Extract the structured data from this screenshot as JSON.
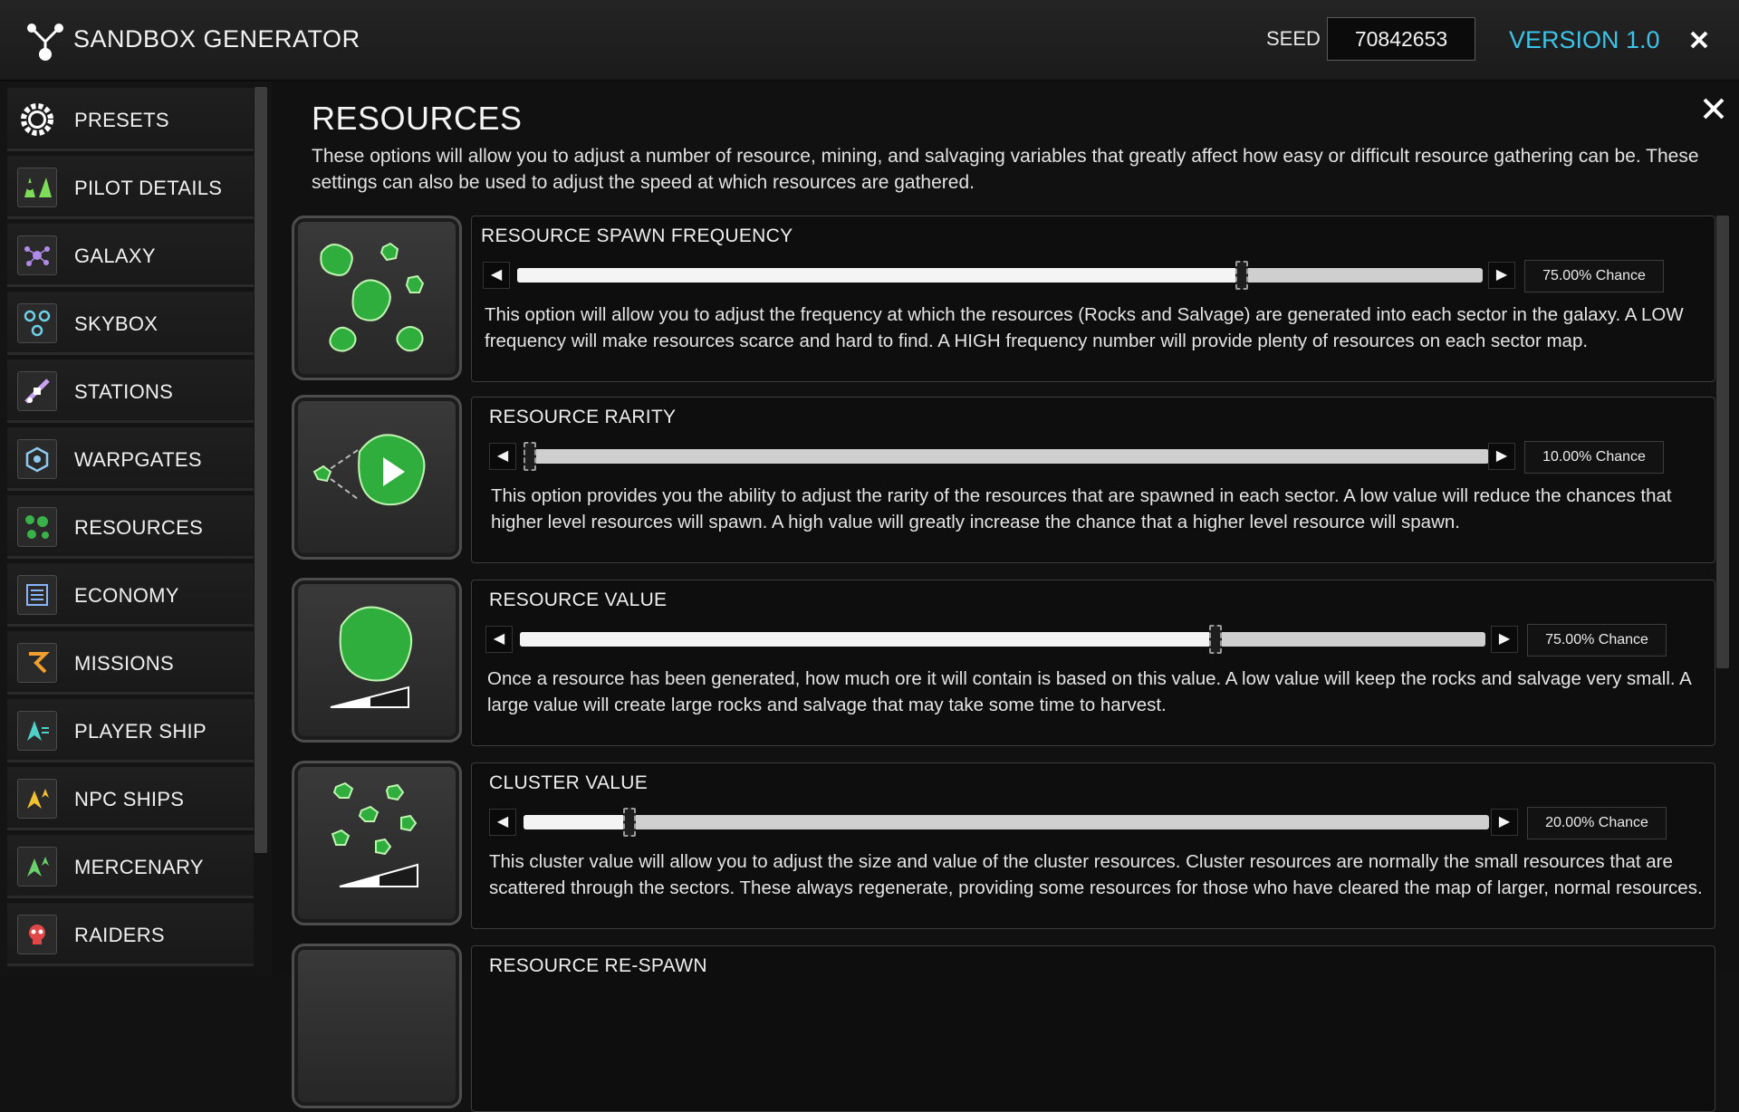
{
  "app": {
    "title": "SANDBOX GENERATOR",
    "seed_label": "SEED",
    "seed_value": "70842653",
    "version": "VERSION 1.0",
    "accent_color": "#3ec2e6"
  },
  "sidebar": {
    "items": [
      {
        "label": "PRESETS",
        "icon": "gear-icon"
      },
      {
        "label": "PILOT DETAILS",
        "icon": "pilot-icon"
      },
      {
        "label": "GALAXY",
        "icon": "galaxy-icon"
      },
      {
        "label": "SKYBOX",
        "icon": "skybox-icon"
      },
      {
        "label": "STATIONS",
        "icon": "station-icon"
      },
      {
        "label": "WARPGATES",
        "icon": "warpgate-icon"
      },
      {
        "label": "RESOURCES",
        "icon": "resources-icon"
      },
      {
        "label": "ECONOMY",
        "icon": "economy-icon"
      },
      {
        "label": "MISSIONS",
        "icon": "missions-icon"
      },
      {
        "label": "PLAYER SHIP",
        "icon": "player-ship-icon"
      },
      {
        "label": "NPC SHIPS",
        "icon": "npc-ships-icon"
      },
      {
        "label": "MERCENARY",
        "icon": "mercenary-icon"
      },
      {
        "label": "RAIDERS",
        "icon": "raiders-icon"
      }
    ]
  },
  "main": {
    "title": "RESOURCES",
    "description": "These options will allow you to adjust a number of resource, mining, and salvaging variables that greatly affect how easy or difficult resource gathering can be. These settings can also be used to adjust the speed at which resources are gathered.",
    "settings": [
      {
        "title": "RESOURCE SPAWN FREQUENCY",
        "value_text": "75.00% Chance",
        "value": 0.75,
        "icon": "resource-cluster-icon",
        "description": "This option will allow you to adjust the frequency at which the resources (Rocks and Salvage) are generated into each sector in the galaxy. A LOW frequency will make resources scarce and hard to find. A HIGH frequency number will provide plenty of resources on each sector map."
      },
      {
        "title": "RESOURCE RARITY",
        "value_text": "10.00% Chance",
        "value": 0.0,
        "icon": "resource-rarity-icon",
        "description": "This option provides you the ability to adjust the rarity of the resources that are spawned in each sector. A low value will reduce the chances that higher level resources will spawn. A high value will greatly increase the chance that a higher level resource will spawn."
      },
      {
        "title": "RESOURCE VALUE",
        "value_text": "75.00% Chance",
        "value": 0.72,
        "icon": "resource-value-icon",
        "description": "Once a resource has been generated, how much ore it will contain is based on this value. A low value will keep the rocks and salvage very small. A large value will create large rocks and salvage that may take some time to harvest."
      },
      {
        "title": "CLUSTER VALUE",
        "value_text": "20.00% Chance",
        "value": 0.11,
        "icon": "cluster-value-icon",
        "description": "This cluster value will allow you to adjust the size and value of the cluster resources. Cluster resources are normally the small resources that are scattered through the sectors. These always regenerate, providing some resources for those who have cleared the map of larger, normal resources."
      },
      {
        "title": "RESOURCE RE-SPAWN"
      }
    ]
  }
}
